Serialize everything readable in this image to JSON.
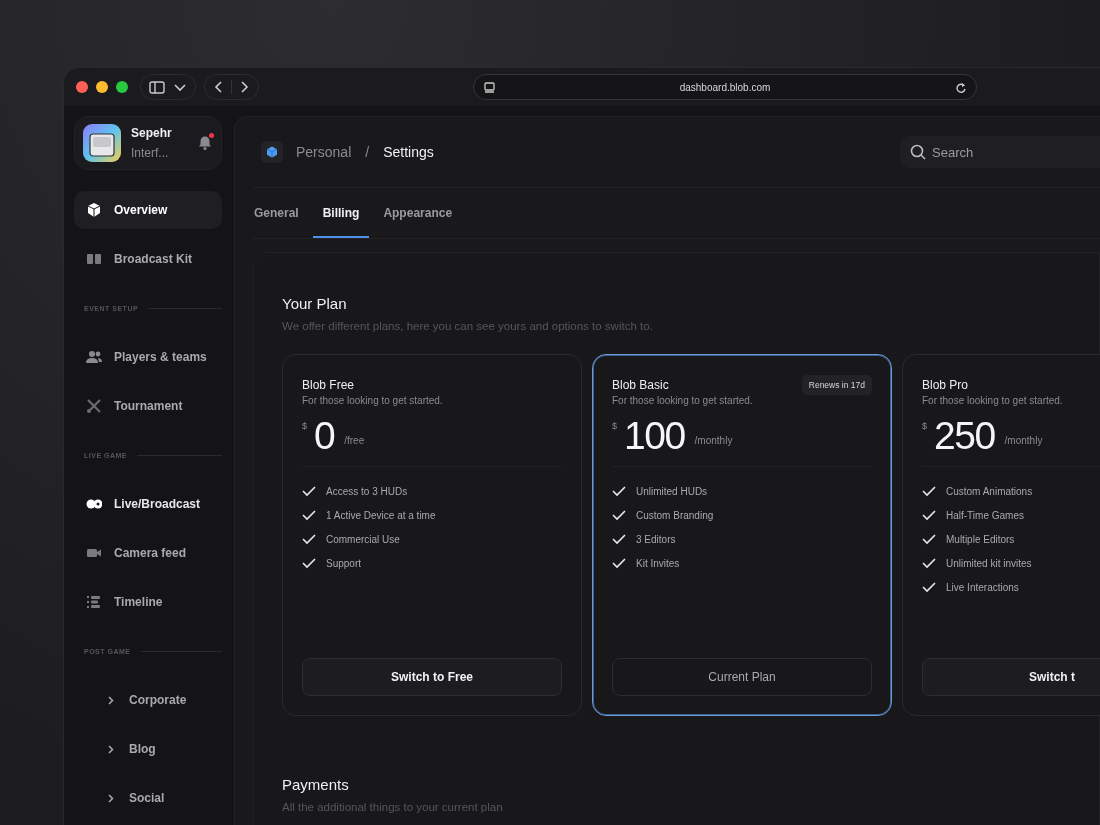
{
  "browser": {
    "url": "dashboard.blob.com"
  },
  "sidebar": {
    "user": {
      "name": "Sepehr",
      "subtitle": "Interf...",
      "notification": true
    },
    "nav": [
      {
        "kind": "item",
        "label": "Overview",
        "selected": true,
        "emphasized": false
      },
      {
        "kind": "item",
        "label": "Broadcast Kit",
        "selected": false,
        "emphasized": false
      },
      {
        "kind": "section",
        "label": "EVENT SETUP"
      },
      {
        "kind": "item",
        "label": "Players & teams",
        "selected": false,
        "emphasized": false
      },
      {
        "kind": "item",
        "label": "Tournament",
        "selected": false,
        "emphasized": false
      },
      {
        "kind": "section",
        "label": "LIVE GAME"
      },
      {
        "kind": "item",
        "label": "Live/Broadcast",
        "selected": false,
        "emphasized": true
      },
      {
        "kind": "item",
        "label": "Camera feed",
        "selected": false,
        "emphasized": false
      },
      {
        "kind": "item",
        "label": "Timeline",
        "selected": false,
        "emphasized": false
      },
      {
        "kind": "section",
        "label": "POST GAME"
      },
      {
        "kind": "folder",
        "label": "Corporate",
        "expanded": false
      },
      {
        "kind": "folder",
        "label": "Blog",
        "expanded": false
      },
      {
        "kind": "folder",
        "label": "Social",
        "expanded": false
      }
    ]
  },
  "header": {
    "breadcrumb": [
      "Personal",
      "/",
      "Settings"
    ],
    "search": {
      "placeholder": "Search"
    }
  },
  "tabs": [
    {
      "label": "General",
      "selected": false
    },
    {
      "label": "Billing",
      "selected": true
    },
    {
      "label": "Appearance",
      "selected": false
    }
  ],
  "plan_section": {
    "title": "Your Plan",
    "subtitle": "We offer different plans, here you can see yours and options to switch to."
  },
  "plans": [
    {
      "name": "Blob Free",
      "subtitle": "For those looking to get started.",
      "currency": "$",
      "price": "0",
      "period": "/free",
      "current": false,
      "features": [
        "Access to 3 HUDs",
        "1 Active Device at a time",
        "Commercial Use",
        "Support"
      ],
      "button": "Switch to Free"
    },
    {
      "name": "Blob Basic",
      "subtitle": "For those looking to get started.",
      "badge": "Renews in 17d",
      "currency": "$",
      "price": "100",
      "period": "/monthly",
      "current": true,
      "features": [
        "Unlimited HUDs",
        "Custom Branding",
        "3 Editors",
        "Kit Invites"
      ],
      "button": "Current Plan"
    },
    {
      "name": "Blob Pro",
      "subtitle": "For those looking to get started.",
      "currency": "$",
      "price": "250",
      "period": "/monthly",
      "current": false,
      "features": [
        "Custom Animations",
        "Half-Time Games",
        "Multiple Editors",
        "Unlimited kit invites",
        "Live Interactions"
      ],
      "button": "Switch t"
    }
  ],
  "payments": {
    "title": "Payments",
    "subtitle": "All the additional things to your current plan"
  }
}
